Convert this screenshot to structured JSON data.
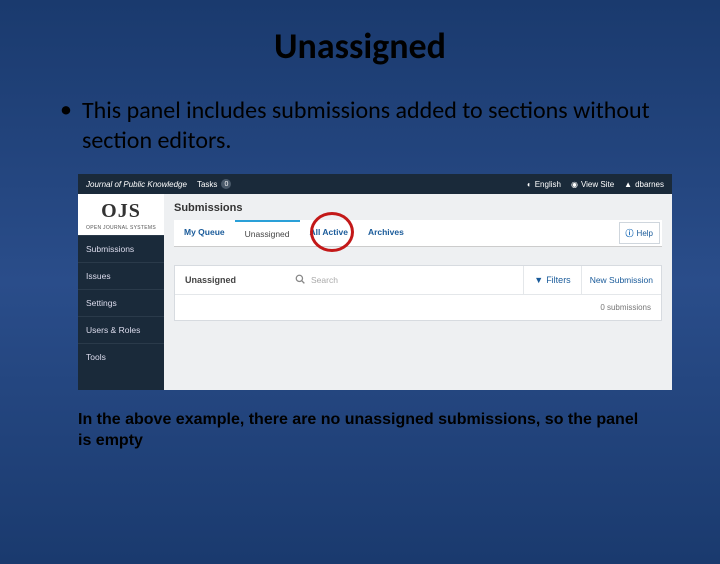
{
  "slide": {
    "title": "Unassigned",
    "bullet": "This panel includes submissions added to sections without section editors.",
    "caption": "In the above example, there are no unassigned submissions, so the panel is empty"
  },
  "app": {
    "topbar": {
      "journal_title": "Journal of Public Knowledge",
      "tasks_label": "Tasks",
      "tasks_count": "0",
      "lang": "English",
      "view_site": "View Site",
      "user": "dbarnes"
    },
    "logo": {
      "main": "OJS",
      "sub": "OPEN JOURNAL SYSTEMS"
    },
    "sidebar": {
      "items": [
        {
          "label": "Submissions"
        },
        {
          "label": "Issues"
        },
        {
          "label": "Settings"
        },
        {
          "label": "Users & Roles"
        },
        {
          "label": "Tools"
        }
      ]
    },
    "content": {
      "heading": "Submissions",
      "tabs": [
        {
          "label": "My Queue"
        },
        {
          "label": "Unassigned"
        },
        {
          "label": "All Active"
        },
        {
          "label": "Archives"
        }
      ],
      "help": "Help",
      "panel": {
        "title": "Unassigned",
        "search_placeholder": "Search",
        "filters": "Filters",
        "new_submission": "New Submission",
        "count_text": "0 submissions"
      }
    }
  }
}
